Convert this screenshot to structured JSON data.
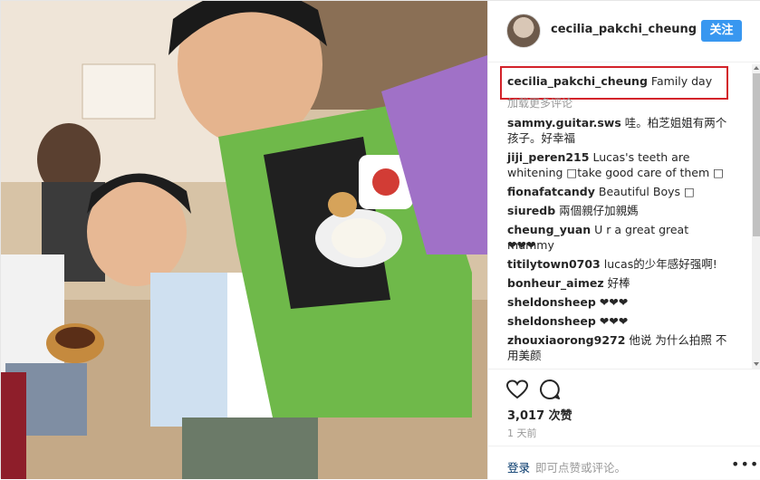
{
  "header": {
    "username": "cecilia_pakchi_cheung",
    "follow_label": "关注"
  },
  "caption": {
    "username": "cecilia_pakchi_cheung",
    "text": "Family day"
  },
  "load_more_label": "加载更多评论",
  "comments": [
    {
      "user": "sammy.guitar.sws",
      "text": "哇。柏芝姐姐有两个",
      "text2": "孩子。好幸福"
    },
    {
      "user": "jiji_peren215",
      "text": "Lucas's teeth are",
      "text2": "whitening □take good care of them □"
    },
    {
      "user": "fionafatcandy",
      "text": "Beautiful Boys □",
      "text2": ""
    },
    {
      "user": "siuredb",
      "text": "兩個親仔加親媽",
      "text2": ""
    },
    {
      "user": "cheung_yuan",
      "text": "U r a great great mummy",
      "text2": "❤❤❤"
    },
    {
      "user": "titilytown0703",
      "text": "lucas的少年感好强啊!",
      "text2": ""
    },
    {
      "user": "bonheur_aimez",
      "text": "好棒",
      "text2": ""
    },
    {
      "user": "sheldonsheep",
      "text": "❤❤❤",
      "text2": ""
    },
    {
      "user": "sheldonsheep",
      "text": "❤❤❤",
      "text2": ""
    },
    {
      "user": "zhouxiaorong9272",
      "text": "他说 为什么拍照 不",
      "text2": "用美颜"
    }
  ],
  "likes": "3,017 次赞",
  "time": "1 天前",
  "footer": {
    "login_label": "登录",
    "prompt": "即可点赞或评论。",
    "more": "•••"
  },
  "icons": {
    "like": "heart-icon",
    "comment": "comment-icon",
    "more": "more-options-icon"
  }
}
